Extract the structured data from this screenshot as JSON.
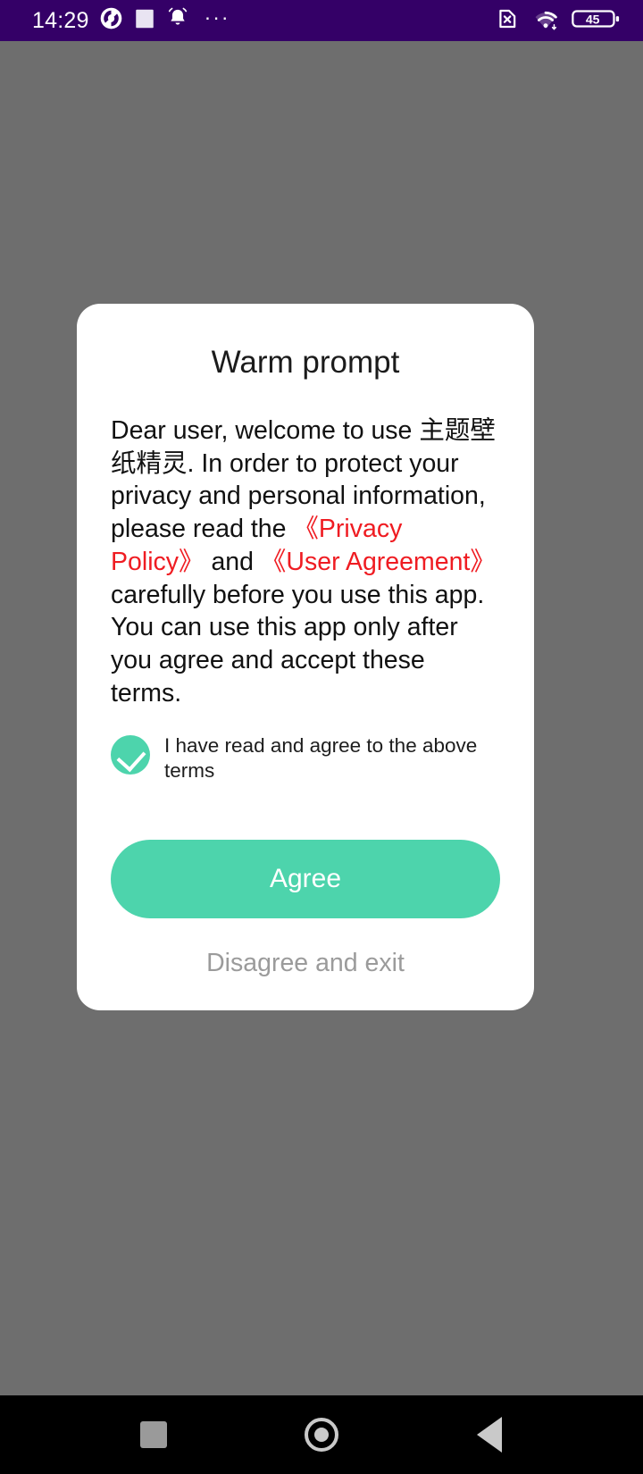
{
  "status_bar": {
    "time": "14:29",
    "background_color": "#340067",
    "left_icons": [
      {
        "name": "app-circle-icon",
        "label": "app notification"
      },
      {
        "name": "square-icon",
        "label": "square notification"
      },
      {
        "name": "bell-icon",
        "label": "alarm"
      }
    ],
    "overflow_dots": "···",
    "right_icons": [
      {
        "name": "no-sim-icon",
        "label": "no SIM card"
      },
      {
        "name": "wifi-icon",
        "label": "wifi connected"
      }
    ],
    "battery_level": "45"
  },
  "dialog": {
    "title": "Warm prompt",
    "message": {
      "part1": "Dear user, welcome to use 主题壁纸精灵. In order to protect your privacy and personal information, please read the ",
      "privacy_policy_link": "《Privacy Policy》",
      "conjunction": " and ",
      "user_agreement_link": "《User Agreement》",
      "part2": " carefully before you use this app. You can use this app only after you agree and accept these terms."
    },
    "checkbox": {
      "label": "I have read and agree to the above terms",
      "checked": true,
      "color": "#4dd4ac"
    },
    "agree_label": "Agree",
    "disagree_label": "Disagree and exit",
    "accent_color": "#4dd4ac",
    "link_color": "#ef1c22"
  },
  "nav_bar": {
    "recents_label": "Recents",
    "home_label": "Home",
    "back_label": "Back"
  }
}
